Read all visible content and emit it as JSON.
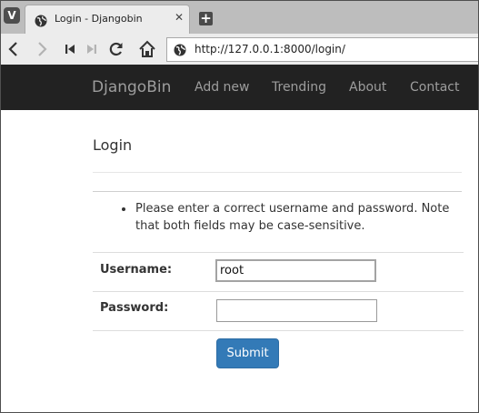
{
  "browser": {
    "app_logo": "V",
    "tab": {
      "title": "Login - Djangobin",
      "close": "✕"
    },
    "new_tab": "+",
    "url": "http://127.0.0.1:8000/login/",
    "icons": {
      "app": "vivaldi-logo-icon",
      "favicon": "globe-icon",
      "back": "back-arrow-icon",
      "forward": "forward-arrow-icon",
      "rewind": "rewind-icon",
      "fast_forward": "fast-forward-icon",
      "reload": "reload-icon",
      "home": "home-icon",
      "site_info": "globe-icon"
    }
  },
  "navbar": {
    "brand": "DjangoBin",
    "links": [
      "Add new",
      "Trending",
      "About",
      "Contact"
    ],
    "background": "#222222",
    "link_color": "#9d9d9d"
  },
  "page": {
    "heading": "Login",
    "errors": [
      "Please enter a correct username and password. Note that both fields may be case-sensitive."
    ],
    "form": {
      "username_label": "Username:",
      "username_value": "root",
      "password_label": "Password:",
      "password_value": "",
      "submit_label": "Submit"
    },
    "accent": "#337ab7"
  }
}
